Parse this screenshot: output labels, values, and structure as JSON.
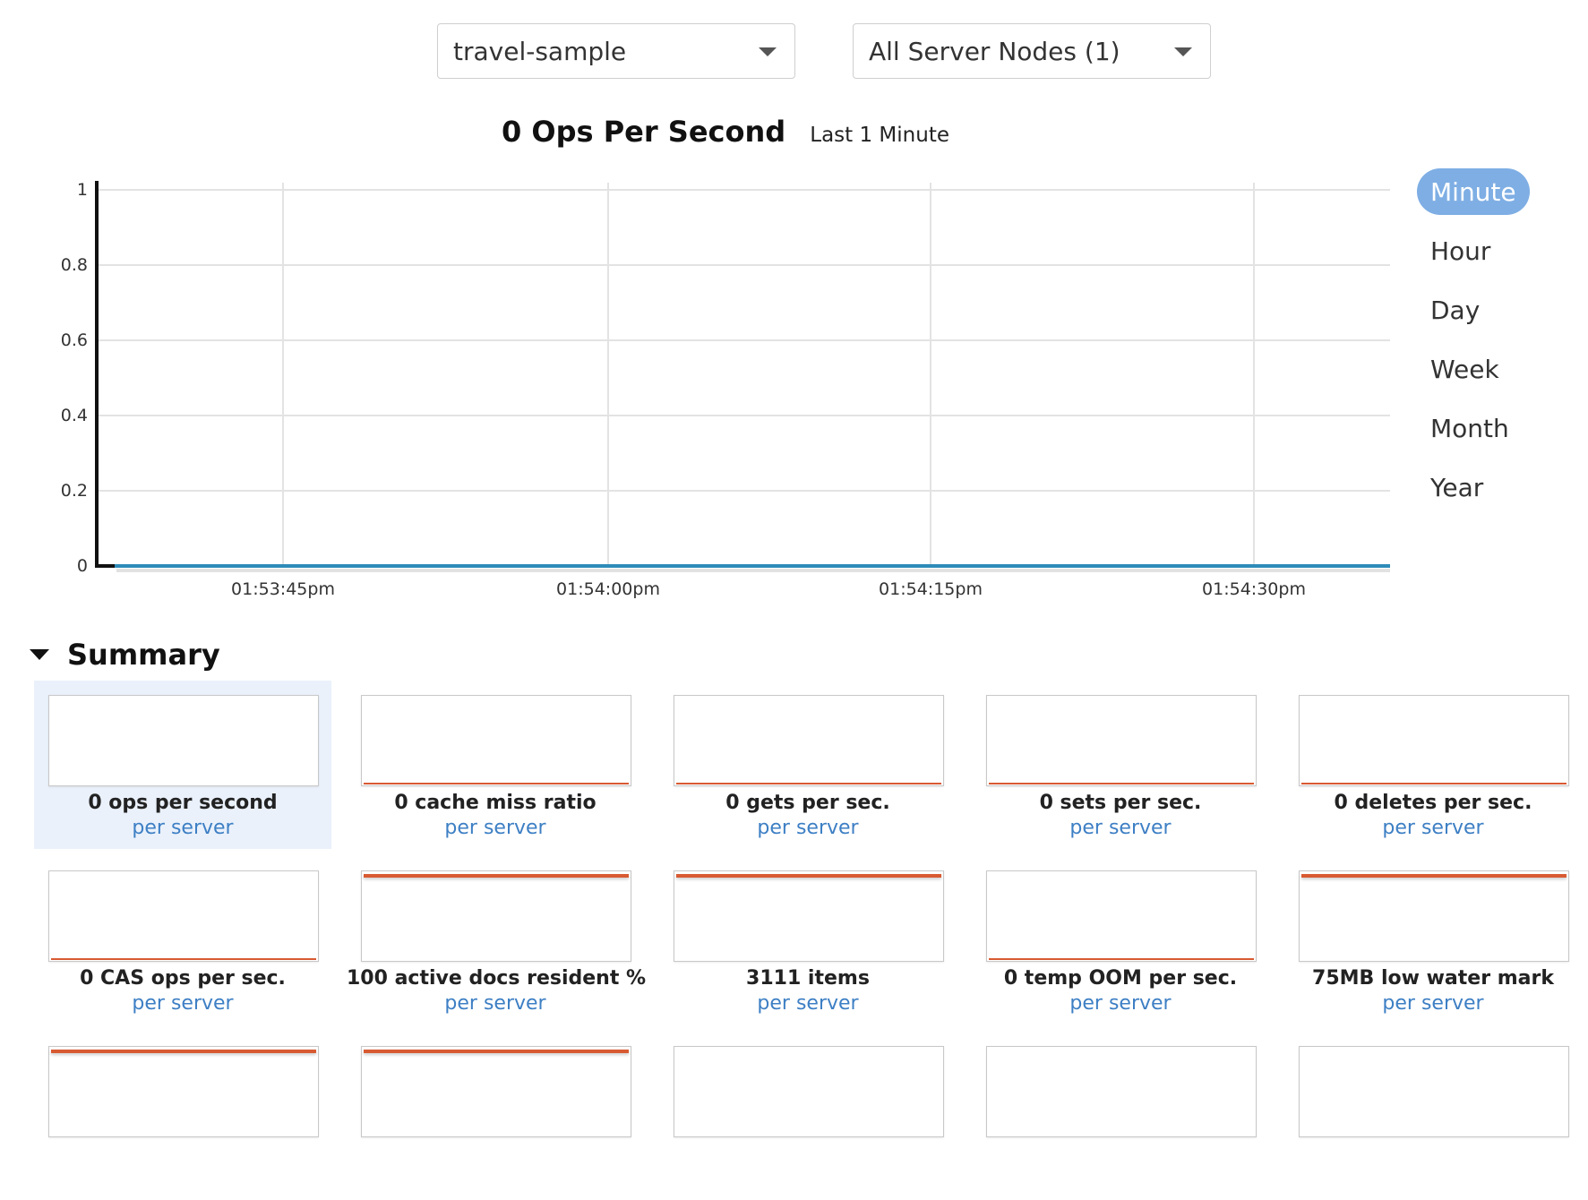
{
  "filters": {
    "bucket": "travel-sample",
    "nodes": "All Server Nodes (1)"
  },
  "chart_header": {
    "title": "0 Ops Per Second",
    "subtitle": "Last 1 Minute"
  },
  "zoom_options": [
    "Minute",
    "Hour",
    "Day",
    "Week",
    "Month",
    "Year"
  ],
  "zoom_selected": "Minute",
  "chart_data": {
    "type": "line",
    "x": [
      "01:53:45pm",
      "01:54:00pm",
      "01:54:15pm",
      "01:54:30pm"
    ],
    "series": [
      {
        "values": [
          0,
          0,
          0,
          0
        ]
      }
    ],
    "yticks": [
      "1",
      "0.8",
      "0.6",
      "0.4",
      "0.2",
      "0"
    ],
    "ylim": [
      0,
      1
    ],
    "grid": true,
    "colors": {
      "line": "#2e8bb8",
      "grid": "#e3e3e3",
      "axis": "#111111"
    }
  },
  "summary": {
    "title": "Summary",
    "tiles": [
      {
        "label": "0 ops per second",
        "sub": "per server",
        "line": "none",
        "selected": true
      },
      {
        "label": "0 cache miss ratio",
        "sub": "per server",
        "line": "bottom"
      },
      {
        "label": "0 gets per sec.",
        "sub": "per server",
        "line": "bottom"
      },
      {
        "label": "0 sets per sec.",
        "sub": "per server",
        "line": "bottom"
      },
      {
        "label": "0 deletes per sec.",
        "sub": "per server",
        "line": "bottom"
      },
      {
        "label": "0 CAS ops per sec.",
        "sub": "per server",
        "line": "bottom"
      },
      {
        "label": "100 active docs resident %",
        "sub": "per server",
        "line": "top"
      },
      {
        "label": "3111 items",
        "sub": "per server",
        "line": "top"
      },
      {
        "label": "0 temp OOM per sec.",
        "sub": "per server",
        "line": "bottom"
      },
      {
        "label": "75MB low water mark",
        "sub": "per server",
        "line": "top"
      },
      {
        "label": "",
        "sub": "",
        "line": "top"
      },
      {
        "label": "",
        "sub": "",
        "line": "top"
      },
      {
        "label": "",
        "sub": "",
        "line": "none"
      },
      {
        "label": "",
        "sub": "",
        "line": "none"
      },
      {
        "label": "",
        "sub": "",
        "line": "none"
      }
    ]
  },
  "colors": {
    "accent": "#7eaee4",
    "link": "#3d7fc4",
    "spark_line": "#d85a32"
  }
}
